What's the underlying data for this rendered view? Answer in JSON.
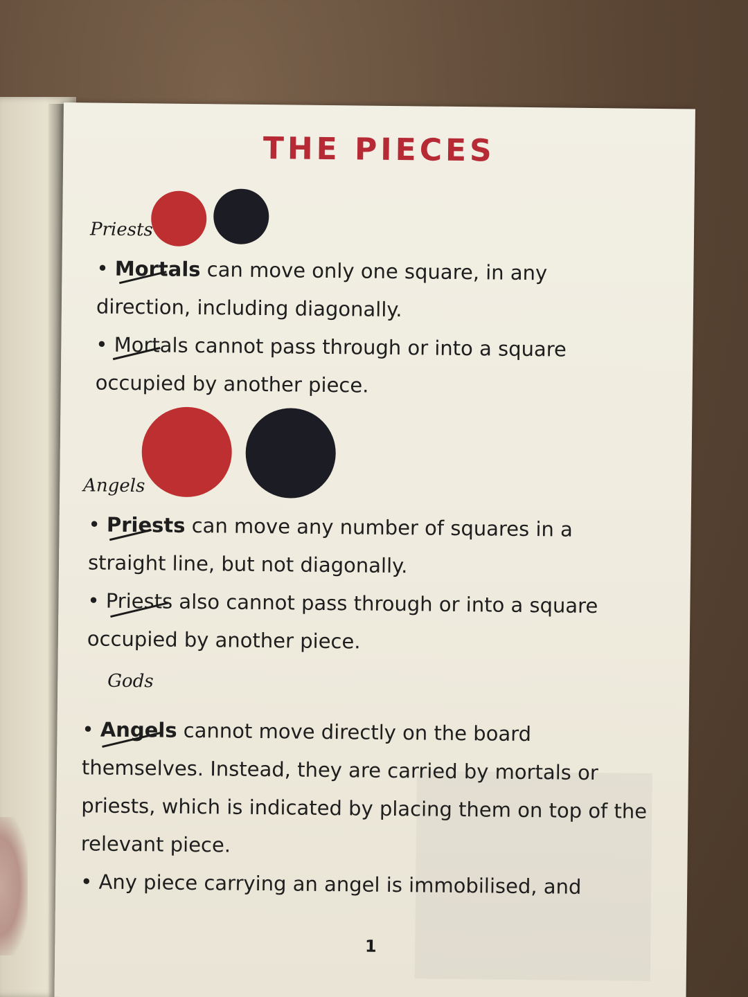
{
  "title": "THE PIECES",
  "handwritten": {
    "mortals_note": "Priests",
    "priests_note": "Angels",
    "angels_note": "Gods"
  },
  "sections": [
    {
      "bullets": [
        {
          "term": "Mortals",
          "rest": " can move only one square, in any direction, including diagonally."
        },
        {
          "term": "Mortals",
          "rest": " cannot pass through or into a square occupied by another piece."
        }
      ]
    },
    {
      "bullets": [
        {
          "term": "Priests",
          "rest": " can move any number of squares in a straight line, but not diagonally."
        },
        {
          "term": "Priests",
          "rest": " also cannot pass through or into a square occupied by another piece."
        }
      ]
    },
    {
      "bullets": [
        {
          "term": "Angels",
          "rest": " cannot move directly on the board themselves. Instead, they are carried by mortals or priests, which is indicated by placing them on top of the relevant piece."
        },
        {
          "term": "",
          "rest": "Any piece carrying an angel is immobilised, and"
        }
      ]
    }
  ],
  "bullet_symbol": "•",
  "page_number": "1",
  "colors": {
    "title": "#b52a34",
    "red_piece": "#bd2f30",
    "black_piece": "#1c1c24"
  }
}
